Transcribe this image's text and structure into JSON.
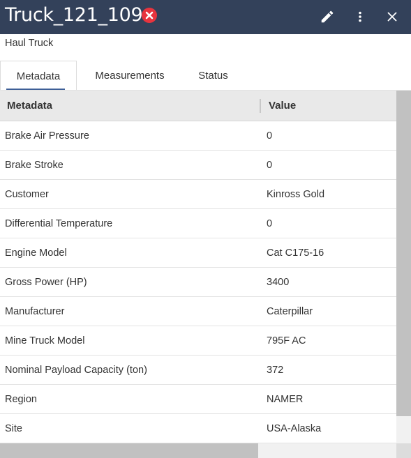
{
  "header": {
    "title": "Truck_121_109",
    "status_icon": "error-icon",
    "status_color": "#e8343e",
    "background": "#33415a",
    "actions": [
      "edit-icon",
      "more-vert-icon",
      "close-icon"
    ]
  },
  "subtitle": "Haul Truck",
  "tabs": [
    {
      "label": "Metadata",
      "active": true
    },
    {
      "label": "Measurements",
      "active": false
    },
    {
      "label": "Status",
      "active": false
    }
  ],
  "table": {
    "columns": [
      "Metadata",
      "Value"
    ],
    "rows": [
      {
        "key": "Brake Air Pressure",
        "value": "0"
      },
      {
        "key": "Brake Stroke",
        "value": "0"
      },
      {
        "key": "Customer",
        "value": "Kinross Gold"
      },
      {
        "key": "Differential Temperature",
        "value": "0"
      },
      {
        "key": "Engine Model",
        "value": "Cat C175-16"
      },
      {
        "key": "Gross Power (HP)",
        "value": "3400"
      },
      {
        "key": "Manufacturer",
        "value": "Caterpillar"
      },
      {
        "key": "Mine Truck Model",
        "value": "795F AC"
      },
      {
        "key": "Nominal Payload Capacity (ton)",
        "value": "372"
      },
      {
        "key": "Region",
        "value": "NAMER"
      },
      {
        "key": "Site",
        "value": "USA-Alaska"
      }
    ]
  },
  "colors": {
    "accent": "#3e5f97",
    "header_row": "#e9e9e9",
    "scrollbar_thumb": "#c1c1c1"
  }
}
